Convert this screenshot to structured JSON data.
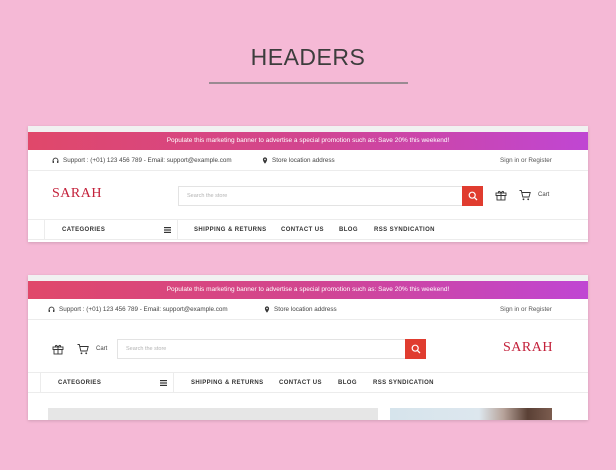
{
  "page": {
    "title": "HEADERS"
  },
  "promo_text": "Populate this marketing banner to advertise a special promotion such as: Save 20% this weekend!",
  "header1": {
    "support": "Support : (+01) 123 456 789 - Email: support@example.com",
    "store_location": "Store location address",
    "signin": "Sign in",
    "or": "or",
    "register": "Register",
    "logo": "SARAH",
    "search_placeholder": "Search the store",
    "cart_label": "Cart",
    "categories": "CATEGORIES",
    "nav": [
      "SHIPPING & RETURNS",
      "CONTACT US",
      "BLOG",
      "RSS SYNDICATION"
    ]
  },
  "header2": {
    "support": "Support : (+01) 123 456 789 - Email: support@example.com",
    "store_location": "Store location address",
    "signin": "Sign in",
    "or": "or",
    "register": "Register",
    "logo": "SARAH",
    "search_placeholder": "Search the store",
    "cart_label": "Cart",
    "categories": "CATEGORIES",
    "nav": [
      "SHIPPING & RETURNS",
      "CONTACT US",
      "BLOG",
      "RSS SYNDICATION"
    ]
  },
  "colors": {
    "background": "#f5b9d6",
    "promo_gradient_start": "#e0486a",
    "promo_gradient_end": "#c046d3",
    "logo": "#c3203a",
    "search_button": "#e03c2f"
  },
  "icons": [
    "headset-icon",
    "map-pin-icon",
    "search-icon",
    "gift-icon",
    "cart-icon",
    "menu-icon"
  ]
}
